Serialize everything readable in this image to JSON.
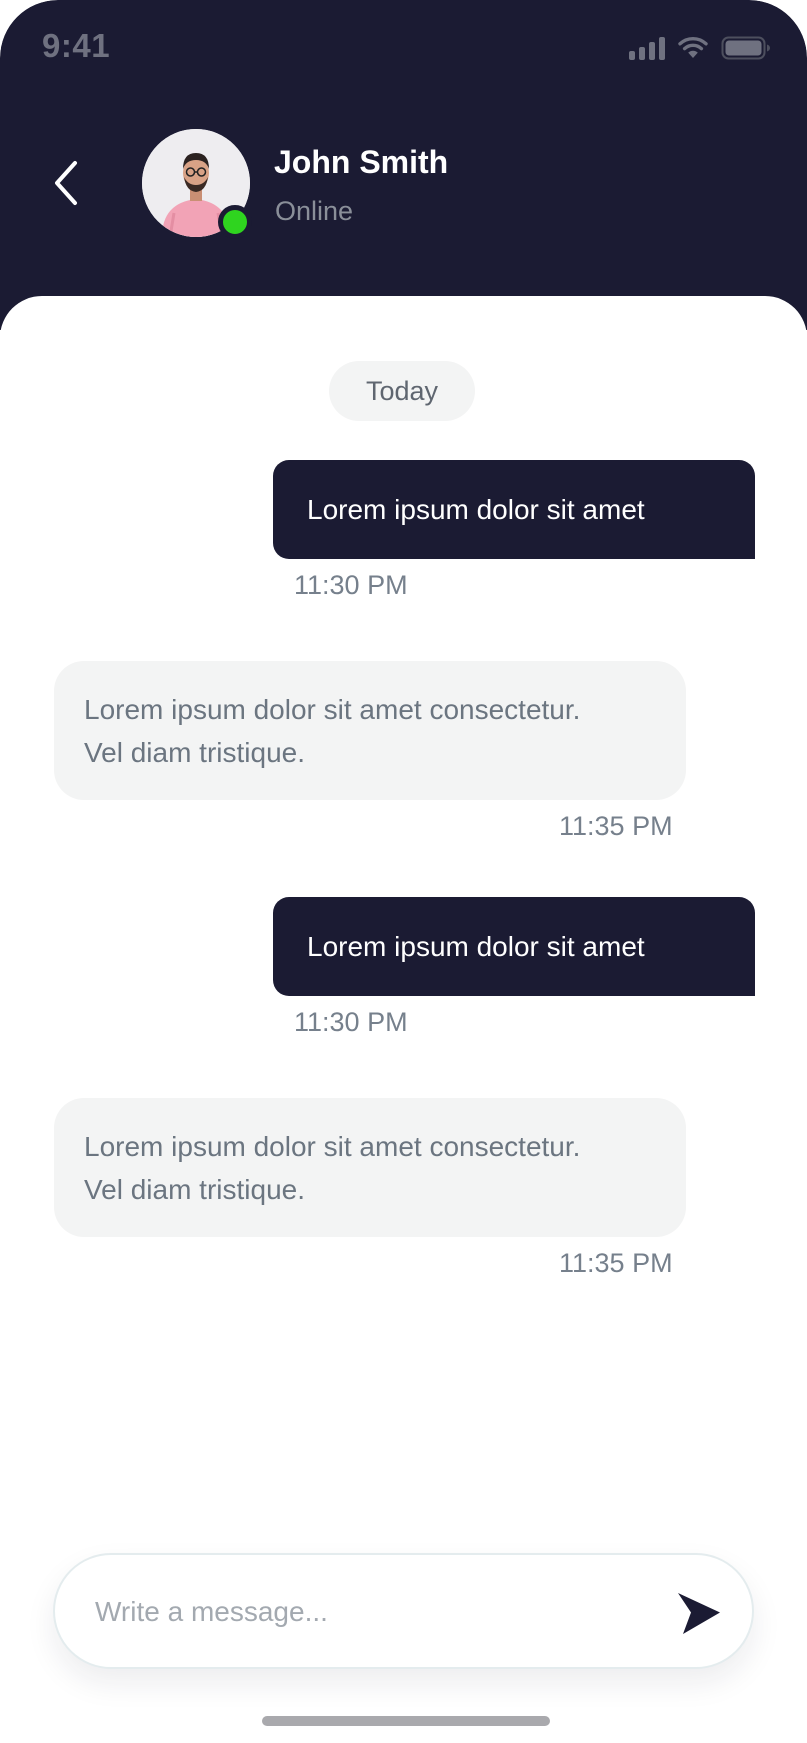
{
  "status_bar": {
    "time": "9:41",
    "icons": [
      "cellular-signal-icon",
      "wifi-icon",
      "battery-icon"
    ]
  },
  "header": {
    "back_icon": "chevron-left-icon",
    "contact": {
      "name": "John Smith",
      "status": "Online",
      "status_color": "#2fd41f"
    }
  },
  "chat": {
    "date_label": "Today",
    "messages": [
      {
        "direction": "sent",
        "text": "Lorem ipsum dolor sit amet",
        "time": "11:30 PM"
      },
      {
        "direction": "received",
        "text": "Lorem ipsum dolor sit amet consectetur.\nVel diam tristique.",
        "time": "11:35 PM"
      },
      {
        "direction": "sent",
        "text": "Lorem ipsum dolor sit amet",
        "time": "11:30 PM"
      },
      {
        "direction": "received",
        "text": "Lorem ipsum dolor sit amet consectetur.\nVel diam tristique.",
        "time": "11:35 PM"
      }
    ]
  },
  "composer": {
    "placeholder": "Write a message...",
    "value": "",
    "send_icon": "send-icon"
  },
  "colors": {
    "header_bg": "#1b1b33",
    "sent_bubble": "#1b1b33",
    "received_bubble": "#f3f4f4",
    "online": "#2fd41f"
  }
}
